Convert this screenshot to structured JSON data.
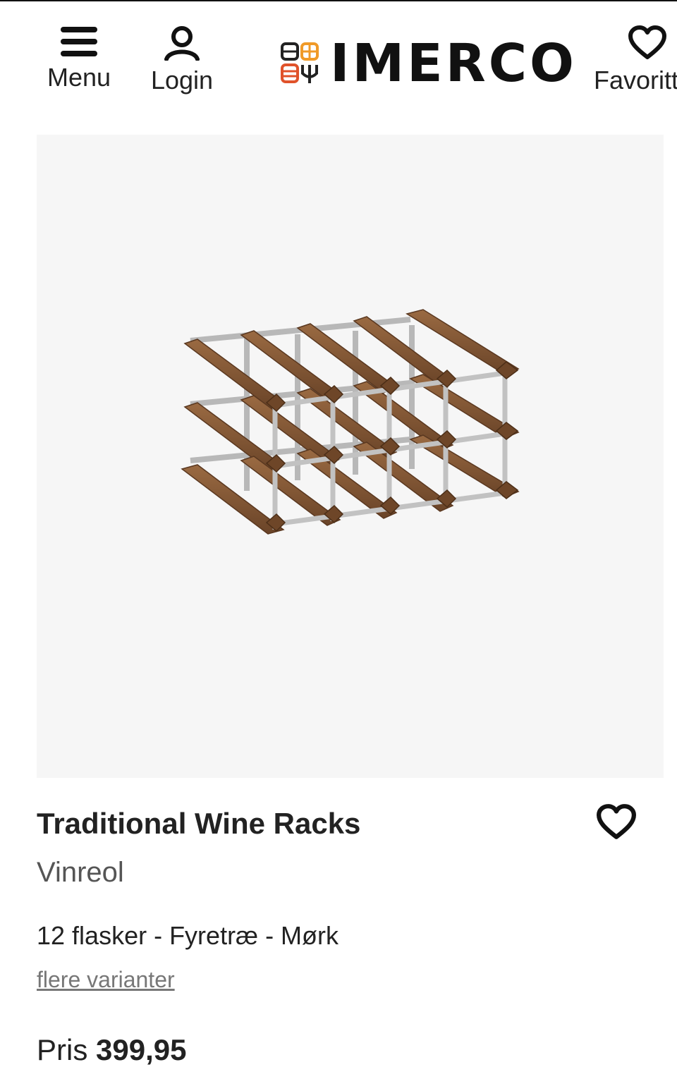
{
  "header": {
    "menu_label": "Menu",
    "login_label": "Login",
    "logo_text": "IMERCO",
    "favorites_label": "Favoritter"
  },
  "product": {
    "image_alt": "Traditional Wine Racks vinreol",
    "title": "Traditional Wine Racks",
    "brand_type": "Vinreol",
    "variant": "12 flasker - Fyretræ - Mørk",
    "more_variants": "flere varianter",
    "price_label": "Pris",
    "price_value": "399,95"
  },
  "colors": {
    "logo_orange": "#e0522a",
    "logo_amber": "#f09a28",
    "wood": "#7a5232",
    "steel": "#b6b6b6"
  },
  "icons": [
    "menu-icon",
    "user-icon",
    "heart-icon",
    "logo-grid-icon"
  ]
}
